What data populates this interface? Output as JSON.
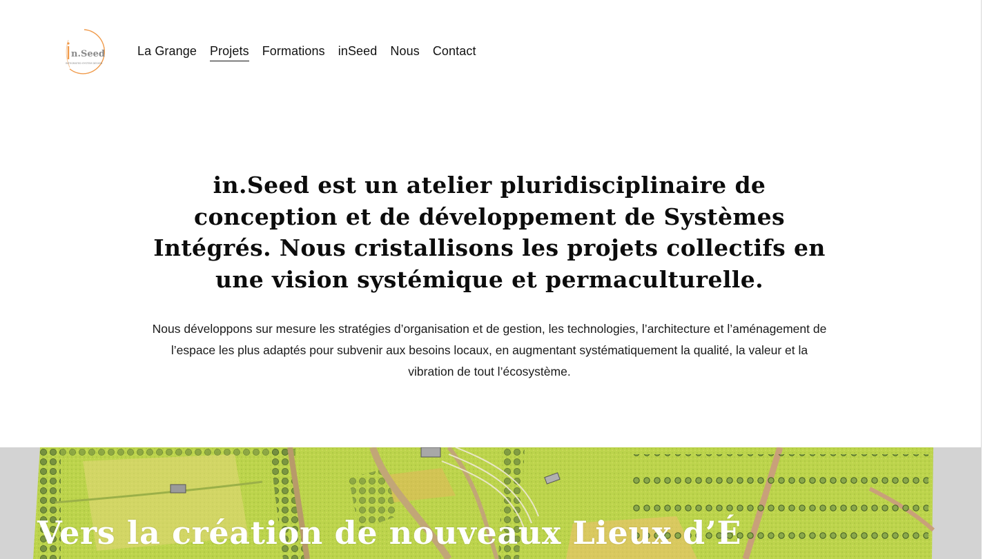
{
  "header": {
    "logo_text": "n.Seed",
    "logo_tagline": "INTEGRATED SYSTEM DESIGN",
    "nav": [
      {
        "label": "La Grange",
        "active": false
      },
      {
        "label": "Projets",
        "active": true
      },
      {
        "label": "Formations",
        "active": false
      },
      {
        "label": "inSeed",
        "active": false
      },
      {
        "label": "Nous",
        "active": false
      },
      {
        "label": "Contact",
        "active": false
      }
    ]
  },
  "intro": {
    "heading": "in.Seed est un atelier pluridisciplinaire de conception et de développement de Systèmes Intégrés. Nous cristallisons les projets collectifs en une vision systémique et permaculturelle.",
    "body": "Nous développons sur mesure les stratégies d’organisation et de gestion, les technologies, l’architecture et l’aménagement de l’espace les plus adaptés pour subvenir aux besoins locaux, en augmentant systématiquement la qualité, la valeur et la vibration de tout l’écosystème."
  },
  "hero": {
    "title": "Vers la création de nouveaux Lieux d’É"
  },
  "colors": {
    "logo_ring": "#f09a4a",
    "text": "#111111",
    "hero_bg": "#d3d3d3",
    "field_green": "#b9d24a",
    "hedge_green": "#5e7a36"
  }
}
